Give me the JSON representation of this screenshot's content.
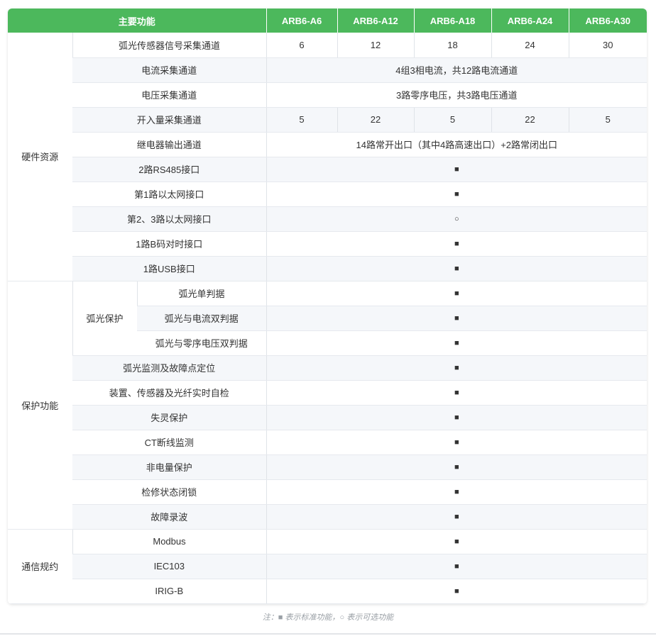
{
  "header": {
    "main": "主要功能",
    "models": [
      "ARB6-A6",
      "ARB6-A12",
      "ARB6-A18",
      "ARB6-A24",
      "ARB6-A30"
    ]
  },
  "groups": {
    "hardware": "硬件资源",
    "protection": "保护功能",
    "arc_protection": "弧光保护",
    "comm": "通信规约"
  },
  "rows": {
    "arc_sensor": {
      "label": "弧光传感器信号采集通道",
      "values": [
        "6",
        "12",
        "18",
        "24",
        "30"
      ]
    },
    "current": {
      "label": "电流采集通道",
      "value": "4组3相电流，共12路电流通道"
    },
    "voltage": {
      "label": "电压采集通道",
      "value": "3路零序电压，共3路电压通道"
    },
    "input": {
      "label": "开入量采集通道",
      "values": [
        "5",
        "22",
        "5",
        "22",
        "5"
      ]
    },
    "relay": {
      "label": "继电器输出通道",
      "value": "14路常开出口（其中4路高速出口）+2路常闭出口"
    },
    "rs485": {
      "label": "2路RS485接口",
      "value": "■"
    },
    "eth1": {
      "label": "第1路以太网接口",
      "value": "■"
    },
    "eth23": {
      "label": "第2、3路以太网接口",
      "value": "○"
    },
    "bcode": {
      "label": "1路B码对时接口",
      "value": "■"
    },
    "usb": {
      "label": "1路USB接口",
      "value": "■"
    },
    "arc_single": {
      "label": "弧光单判据",
      "value": "■"
    },
    "arc_current": {
      "label": "弧光与电流双判据",
      "value": "■"
    },
    "arc_voltage": {
      "label": "弧光与零序电压双判据",
      "value": "■"
    },
    "arc_monitor": {
      "label": "弧光监测及故障点定位",
      "value": "■"
    },
    "selfcheck": {
      "label": "装置、传感器及光纤实时自检",
      "value": "■"
    },
    "failsafe": {
      "label": "失灵保护",
      "value": "■"
    },
    "ct": {
      "label": "CT断线监测",
      "value": "■"
    },
    "nonelectric": {
      "label": "非电量保护",
      "value": "■"
    },
    "maintenance": {
      "label": "检修状态闭锁",
      "value": "■"
    },
    "recording": {
      "label": "故障录波",
      "value": "■"
    },
    "modbus": {
      "label": "Modbus",
      "value": "■"
    },
    "iec103": {
      "label": "IEC103",
      "value": "■"
    },
    "irigb": {
      "label": "IRIG-B",
      "value": "■"
    }
  },
  "note": "注：■ 表示标准功能，○ 表示可选功能",
  "colors": {
    "header_bg": "#4cb85c",
    "header_text": "#ffffff",
    "stripe": "#f5f7fa"
  }
}
